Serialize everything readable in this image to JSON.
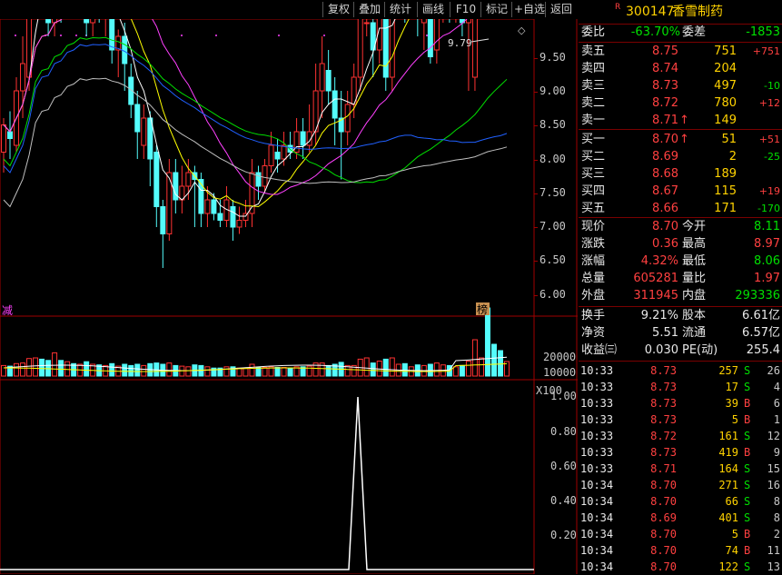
{
  "toolbar": {
    "buttons": [
      "复权",
      "叠加",
      "统计",
      "画线",
      "F10",
      "标记",
      "+自选",
      "返回"
    ]
  },
  "chart": {
    "kline_axis": [
      "9.50",
      "9.00",
      "8.50",
      "8.00",
      "7.50",
      "7.00",
      "6.50",
      "6.00"
    ],
    "volume_axis": [
      "20000",
      "10000"
    ],
    "volume_unit": "X100",
    "indicator_axis": [
      "1.00",
      "0.80",
      "0.60",
      "0.40",
      "0.20"
    ],
    "max_label": "9.79",
    "left_badge": "减",
    "right_badge": "榜",
    "colors": {
      "up": "#ff3232",
      "down": "#54fcfc",
      "ma5": "#ffffff",
      "ma10": "#ffff00",
      "ma20": "#ff40ff",
      "ma30": "#00e000",
      "ma60": "#2060ff",
      "ma120": "#c0c0c0"
    }
  },
  "quote": {
    "code": "300147",
    "name": "香雪制药",
    "r_mark": "R",
    "weibi_label": "委比",
    "weibi_value": "-63.70%",
    "weicha_label": "委差",
    "weicha_value": "-1853",
    "sell": [
      {
        "label": "卖五",
        "price": "8.75",
        "vol": "751",
        "chg": "+751"
      },
      {
        "label": "卖四",
        "price": "8.74",
        "vol": "204",
        "chg": ""
      },
      {
        "label": "卖三",
        "price": "8.73",
        "vol": "497",
        "chg": "-10"
      },
      {
        "label": "卖二",
        "price": "8.72",
        "vol": "780",
        "chg": "+12"
      },
      {
        "label": "卖一",
        "price": "8.71",
        "vol": "149",
        "chg": "",
        "arrow": "↑"
      }
    ],
    "buy": [
      {
        "label": "买一",
        "price": "8.70",
        "vol": "51",
        "chg": "+51",
        "arrow": "↑"
      },
      {
        "label": "买二",
        "price": "8.69",
        "vol": "2",
        "chg": "-25"
      },
      {
        "label": "买三",
        "price": "8.68",
        "vol": "189",
        "chg": ""
      },
      {
        "label": "买四",
        "price": "8.67",
        "vol": "115",
        "chg": "+19"
      },
      {
        "label": "买五",
        "price": "8.66",
        "vol": "171",
        "chg": "-170"
      }
    ],
    "stats": [
      {
        "l1": "现价",
        "v1": "8.70",
        "l2": "今开",
        "v2": "8.11"
      },
      {
        "l1": "涨跌",
        "v1": "0.36",
        "l2": "最高",
        "v2": "8.97"
      },
      {
        "l1": "涨幅",
        "v1": "4.32%",
        "l2": "最低",
        "v2": "8.06"
      },
      {
        "l1": "总量",
        "v1": "605281",
        "l2": "量比",
        "v2": "1.97"
      },
      {
        "l1": "外盘",
        "v1": "311945",
        "l2": "内盘",
        "v2": "293336"
      }
    ],
    "stats2": [
      {
        "l1": "换手",
        "v1": "9.21%",
        "l2": "股本",
        "v2": "6.61亿"
      },
      {
        "l1": "净资",
        "v1": "5.51",
        "l2": "流通",
        "v2": "6.57亿"
      },
      {
        "l1": "收益㈢",
        "v1": "0.030",
        "l2": "PE(动)",
        "v2": "255.4"
      }
    ],
    "ticks": [
      {
        "time": "10:33",
        "price": "8.73",
        "vol": "257",
        "bs": "S",
        "n": "26"
      },
      {
        "time": "10:33",
        "price": "8.73",
        "vol": "17",
        "bs": "S",
        "n": "4"
      },
      {
        "time": "10:33",
        "price": "8.73",
        "vol": "39",
        "bs": "B",
        "n": "6"
      },
      {
        "time": "10:33",
        "price": "8.73",
        "vol": "5",
        "bs": "B",
        "n": "1"
      },
      {
        "time": "10:33",
        "price": "8.72",
        "vol": "161",
        "bs": "S",
        "n": "12"
      },
      {
        "time": "10:33",
        "price": "8.73",
        "vol": "419",
        "bs": "B",
        "n": "9"
      },
      {
        "time": "10:33",
        "price": "8.71",
        "vol": "164",
        "bs": "S",
        "n": "15"
      },
      {
        "time": "10:34",
        "price": "8.70",
        "vol": "271",
        "bs": "S",
        "n": "16"
      },
      {
        "time": "10:34",
        "price": "8.70",
        "vol": "66",
        "bs": "S",
        "n": "8"
      },
      {
        "time": "10:34",
        "price": "8.69",
        "vol": "401",
        "bs": "S",
        "n": "8"
      },
      {
        "time": "10:34",
        "price": "8.70",
        "vol": "5",
        "bs": "B",
        "n": "2"
      },
      {
        "time": "10:34",
        "price": "8.70",
        "vol": "74",
        "bs": "B",
        "n": "11"
      },
      {
        "time": "10:34",
        "price": "8.70",
        "vol": "122",
        "bs": "S",
        "n": "13"
      }
    ]
  }
}
